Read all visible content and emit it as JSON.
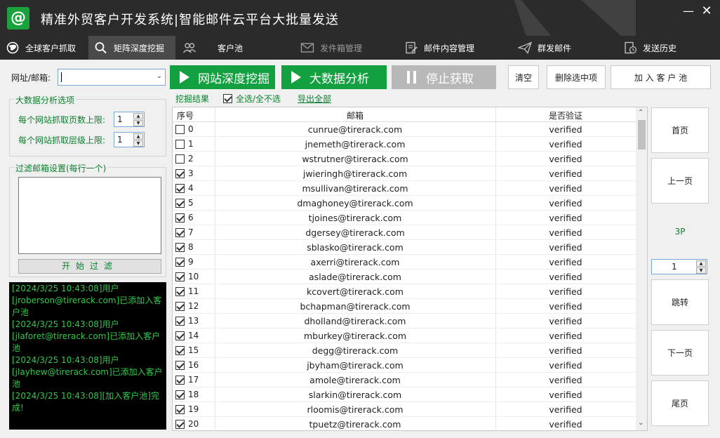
{
  "app": {
    "title": "精准外贸客户开发系统|智能邮件云平台大批量发送",
    "logo": "@"
  },
  "tabs": [
    {
      "label": "全球客户抓取",
      "icon": "globe-icon"
    },
    {
      "label": "矩阵深度挖掘",
      "icon": "search-icon"
    },
    {
      "label": "客户池",
      "icon": "users-icon"
    },
    {
      "label": "发件箱管理",
      "icon": "mail-icon"
    },
    {
      "label": "邮件内容管理",
      "icon": "edit-doc-icon"
    },
    {
      "label": "群发邮件",
      "icon": "send-icon"
    },
    {
      "label": "发送历史",
      "icon": "history-icon"
    }
  ],
  "toolbar": {
    "url_label": "网址/邮箱:",
    "url_value": "",
    "deep_mine": "网站深度挖掘",
    "big_data": "大数据分析",
    "stop": "停止获取",
    "clear": "清空",
    "delete_selected": "删除选中项",
    "add_pool": "加 入 客 户 池"
  },
  "options": {
    "title": "大数据分析选项",
    "pages_label": "每个网站抓取页数上限:",
    "pages_value": "1",
    "depth_label": "每个网站抓取层级上限:",
    "depth_value": "1"
  },
  "filter": {
    "title": "过滤邮箱设置(每行一个)",
    "value": "",
    "start": "开始过滤"
  },
  "log": [
    "[2024/3/25 10:43:08]用户[jroberson@tirerack.com]已添加入客户池",
    "[2024/3/25 10:43:08]用户[jlaforet@tirerack.com]已添加入客户池",
    "[2024/3/25 10:43:08]用户[jlayhew@tirerack.com]已添加入客户池",
    "[2024/3/25 10:43:08][加入客户池]完成!"
  ],
  "results": {
    "title": "挖掘结果",
    "select_all": "全选/全不选",
    "export_all": "导出全部",
    "columns": {
      "no": "序号",
      "email": "邮箱",
      "verified": "是否验证"
    },
    "rows": [
      {
        "no": "0",
        "email": "cunrue@tirerack.com",
        "status": "verified",
        "checked": false
      },
      {
        "no": "1",
        "email": "jnemeth@tirerack.com",
        "status": "verified",
        "checked": false
      },
      {
        "no": "2",
        "email": "wstrutner@tirerack.com",
        "status": "verified",
        "checked": false
      },
      {
        "no": "3",
        "email": "jwieringh@tirerack.com",
        "status": "verified",
        "checked": true
      },
      {
        "no": "4",
        "email": "msullivan@tirerack.com",
        "status": "verified",
        "checked": true
      },
      {
        "no": "5",
        "email": "dmaghoney@tirerack.com",
        "status": "verified",
        "checked": true
      },
      {
        "no": "6",
        "email": "tjoines@tirerack.com",
        "status": "verified",
        "checked": true
      },
      {
        "no": "7",
        "email": "dgersey@tirerack.com",
        "status": "verified",
        "checked": true
      },
      {
        "no": "8",
        "email": "sblasko@tirerack.com",
        "status": "verified",
        "checked": true
      },
      {
        "no": "9",
        "email": "axerri@tirerack.com",
        "status": "verified",
        "checked": true
      },
      {
        "no": "10",
        "email": "aslade@tirerack.com",
        "status": "verified",
        "checked": true
      },
      {
        "no": "11",
        "email": "kcovert@tirerack.com",
        "status": "verified",
        "checked": true
      },
      {
        "no": "12",
        "email": "bchapman@tirerack.com",
        "status": "verified",
        "checked": true
      },
      {
        "no": "13",
        "email": "dholland@tirerack.com",
        "status": "verified",
        "checked": true
      },
      {
        "no": "14",
        "email": "mburkey@tirerack.com",
        "status": "verified",
        "checked": true
      },
      {
        "no": "15",
        "email": "degg@tirerack.com",
        "status": "verified",
        "checked": true
      },
      {
        "no": "16",
        "email": "jbyham@tirerack.com",
        "status": "verified",
        "checked": true
      },
      {
        "no": "17",
        "email": "amole@tirerack.com",
        "status": "verified",
        "checked": true
      },
      {
        "no": "18",
        "email": "slarkin@tirerack.com",
        "status": "verified",
        "checked": true
      },
      {
        "no": "19",
        "email": "rloomis@tirerack.com",
        "status": "verified",
        "checked": true
      },
      {
        "no": "20",
        "email": "tpuetz@tirerack.com",
        "status": "verified",
        "checked": true
      }
    ]
  },
  "pager": {
    "first": "首页",
    "prev": "上一页",
    "indicator": "3P",
    "page_value": "1",
    "jump": "跳转",
    "next": "下一页",
    "last": "尾页"
  },
  "colors": {
    "brand_green": "#13a040",
    "text_green": "#0a7f2e",
    "titlebar": "#2b2b2b"
  }
}
